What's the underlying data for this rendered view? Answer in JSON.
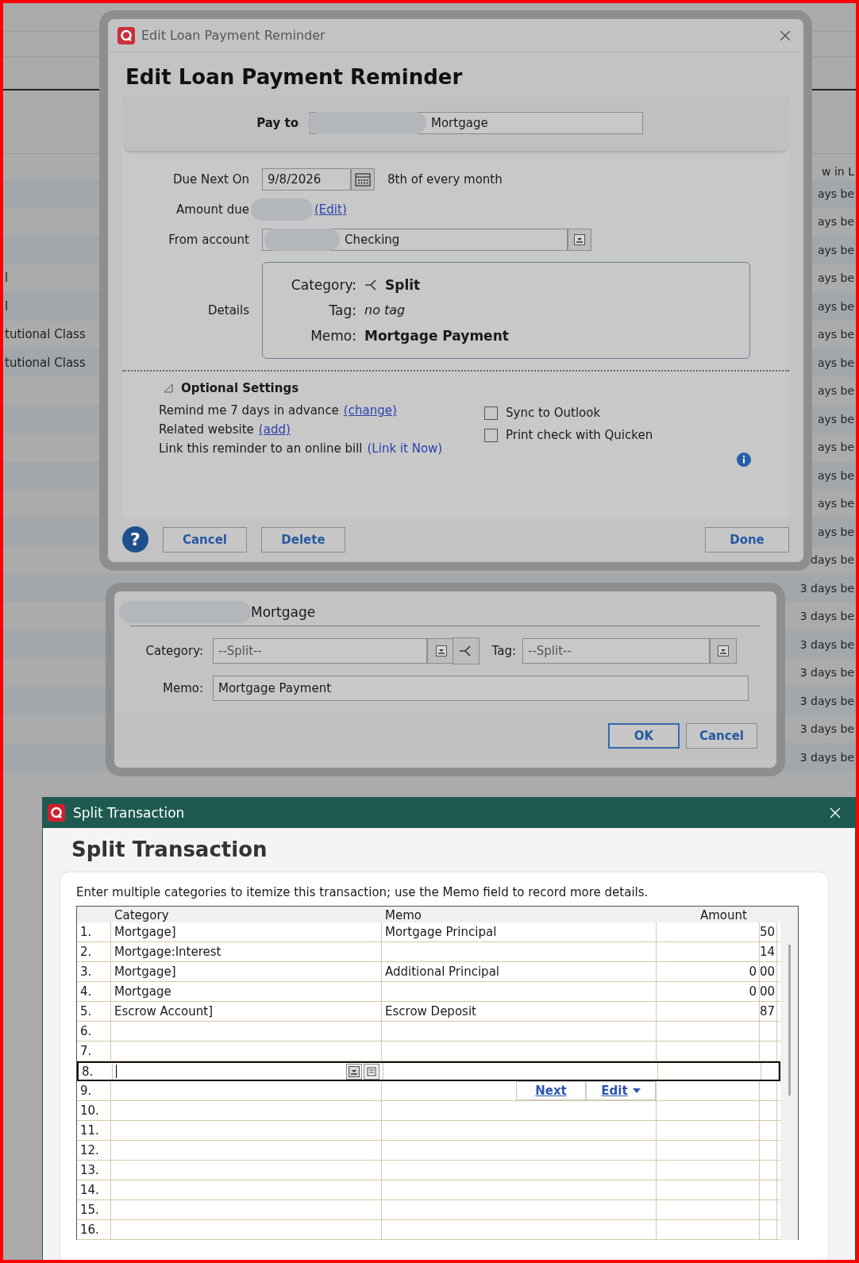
{
  "background": {
    "left_rows": [
      "l",
      "l",
      "tutional Class",
      "tutional Class"
    ],
    "right_header": "w in L",
    "right_rows": [
      "ays be",
      "ays be",
      "ays be",
      "ays be",
      "ays be",
      "ays be",
      "ays be",
      "ays be",
      "ays be",
      "ays be",
      "ays be",
      "ays be",
      "ays be",
      "days be",
      "3 days be",
      "3 days be",
      "3 days be",
      "3 days be",
      "3 days be",
      "3 days be",
      "3 days be"
    ]
  },
  "reminder_dialog": {
    "title": "Edit Loan Payment Reminder",
    "heading": "Edit Loan Payment Reminder",
    "pay_to": {
      "label": "Pay to",
      "value": "Mortgage",
      "redacted": true
    },
    "due_next_on": {
      "label": "Due Next On",
      "value": "9/8/2026",
      "recurrence": "8th of every month"
    },
    "amount_due": {
      "label": "Amount due",
      "link": "(Edit)",
      "redacted": true
    },
    "from_account": {
      "label": "From account",
      "value": "Checking",
      "redacted": true
    },
    "details": {
      "label": "Details",
      "category_label": "Category:",
      "category": "Split",
      "tag_label": "Tag:",
      "tag": "no tag",
      "memo_label": "Memo:",
      "memo": "Mortgage Payment"
    },
    "optional_settings": {
      "title": "Optional Settings",
      "expanded": true,
      "lines": [
        {
          "text": "Remind me 7 days in advance",
          "link": "(change)",
          "underlined": true
        },
        {
          "text": "Related website",
          "link": "(add)",
          "underlined": true
        },
        {
          "text": "Link this reminder to an online bill",
          "link": "(Link it Now)",
          "underlined": false
        }
      ],
      "checkboxes": [
        {
          "label": "Sync to Outlook",
          "checked": false
        },
        {
          "label": "Print check with Quicken",
          "checked": false
        }
      ]
    },
    "help": "?",
    "buttons_left": [
      "Cancel",
      "Delete"
    ],
    "button_right": "Done"
  },
  "payment_dialog": {
    "payee": "Mortgage",
    "redacted": true,
    "category_label": "Category:",
    "category": "--Split--",
    "tag_label": "Tag:",
    "tag": "--Split--",
    "memo_label": "Memo:",
    "memo": "Mortgage Payment",
    "buttons": [
      {
        "label": "OK",
        "default": true
      },
      {
        "label": "Cancel",
        "default": false
      }
    ]
  },
  "split_window": {
    "title": "Split Transaction",
    "heading": "Split Transaction",
    "instruction": "Enter multiple categories to itemize this transaction; use the Memo field to record more details.",
    "columns": [
      "Category",
      "Memo",
      "Amount"
    ],
    "rows": [
      {
        "number": "1.",
        "category": "Mortgage]",
        "memo": "Mortgage Principal",
        "amount": "",
        "cents": "50",
        "selected": false
      },
      {
        "number": "2.",
        "category": "Mortgage:Interest",
        "memo": "",
        "amount": "",
        "cents": "14",
        "selected": false
      },
      {
        "number": "3.",
        "category": "Mortgage]",
        "memo": "Additional Principal",
        "amount": "0",
        "cents": "00",
        "selected": false
      },
      {
        "number": "4.",
        "category": "Mortgage",
        "memo": "",
        "amount": "0",
        "cents": "00",
        "selected": false
      },
      {
        "number": "5.",
        "category": "Escrow Account]",
        "memo": "Escrow Deposit",
        "amount": "",
        "cents": "87",
        "selected": false
      },
      {
        "number": "6.",
        "category": "",
        "memo": "",
        "amount": "",
        "cents": "",
        "selected": false
      },
      {
        "number": "7.",
        "category": "",
        "memo": "",
        "amount": "",
        "cents": "",
        "selected": false
      },
      {
        "number": "8.",
        "category": "",
        "memo": "",
        "amount": "",
        "cents": "",
        "selected": true
      },
      {
        "number": "9.",
        "category": "",
        "memo": "",
        "amount": "",
        "cents": "",
        "selected": false,
        "actions": [
          "Next",
          "Edit"
        ]
      },
      {
        "number": "10.",
        "category": "",
        "memo": "",
        "amount": "",
        "cents": "",
        "selected": false
      },
      {
        "number": "11.",
        "category": "",
        "memo": "",
        "amount": "",
        "cents": "",
        "selected": false
      },
      {
        "number": "12.",
        "category": "",
        "memo": "",
        "amount": "",
        "cents": "",
        "selected": false
      },
      {
        "number": "13.",
        "category": "",
        "memo": "",
        "amount": "",
        "cents": "",
        "selected": false
      },
      {
        "number": "14.",
        "category": "",
        "memo": "",
        "amount": "",
        "cents": "",
        "selected": false
      },
      {
        "number": "15.",
        "category": "",
        "memo": "",
        "amount": "",
        "cents": "",
        "selected": false
      },
      {
        "number": "16.",
        "category": "",
        "memo": "",
        "amount": "",
        "cents": "",
        "selected": false
      }
    ]
  }
}
